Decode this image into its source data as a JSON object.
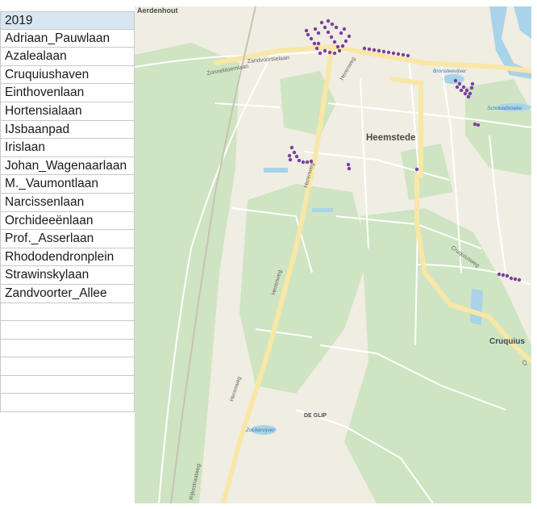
{
  "table": {
    "header": "2019",
    "rows": [
      "Adriaan_Pauwlaan",
      "Azalealaan",
      "Cruquiushaven",
      "Einthovenlaan",
      "Hortensialaan",
      "IJsbaanpad",
      "Irislaan",
      "Johan_Wagenaarlaan",
      "M._Vaumontlaan",
      "Narcissenlaan",
      "Orchideeënlaan",
      "Prof._Asserlaan",
      "Rhododendronplein",
      "Strawinskylaan",
      "Zandvoorter_Allee",
      "",
      "",
      "",
      "",
      "",
      ""
    ]
  },
  "map": {
    "places": {
      "aerdenhout": "Aerdenhout",
      "heemstede": "Heemstede",
      "cruquius": "Cruquius",
      "de_glip": "DE GLIP"
    },
    "roads": {
      "zandvoortselaan": "Zandvoortselaan",
      "zonnebloemlaan": "Zonnebloemlaan",
      "herenweg_1": "Herenweg",
      "herenweg_2": "Herenweg",
      "herenweg_3": "Herenweg",
      "herenweg_4": "Herenweg",
      "cruquiusweg": "Cruquiusweg",
      "rijksstraatweg": "Rijksstraatweg"
    },
    "water": {
      "bronsteevijver": "Bronsteevijver",
      "schouwbroek": "Schouwbroeke",
      "zochervijver": "Zochervijver",
      "cruquius_edge": "Cr"
    },
    "colors": {
      "urban": "#f0ede3",
      "green": "#cfe4c2",
      "water": "#a9d3e8",
      "major_road": "#f8e7a6",
      "road": "#ffffff",
      "marker": "#7b3fa3"
    }
  }
}
